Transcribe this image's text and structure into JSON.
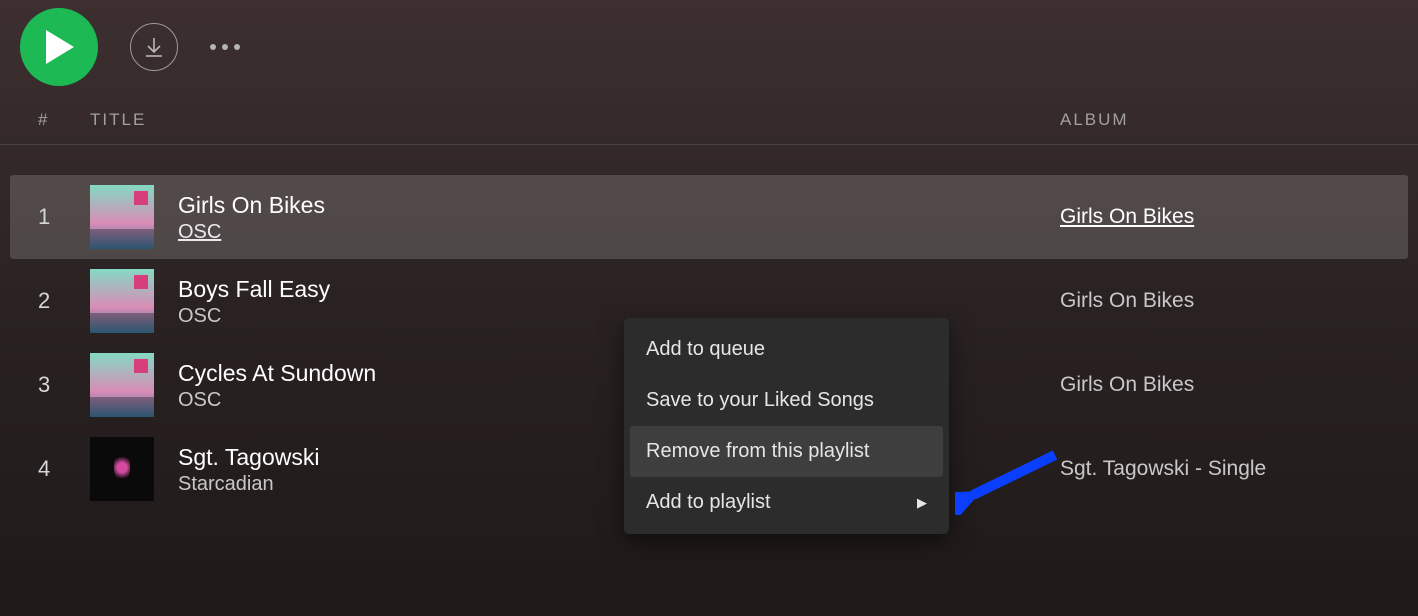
{
  "toolbar": {
    "play_icon": "play-icon",
    "download_icon": "download-icon",
    "more_icon": "more-icon"
  },
  "columns": {
    "number": "#",
    "title": "TITLE",
    "album": "ALBUM"
  },
  "tracks": [
    {
      "num": "1",
      "title": "Girls On Bikes",
      "artist": "OSC",
      "album": "Girls On Bikes",
      "selected": true,
      "art": "synth"
    },
    {
      "num": "2",
      "title": "Boys Fall Easy",
      "artist": "OSC",
      "album": "Girls On Bikes",
      "selected": false,
      "art": "synth"
    },
    {
      "num": "3",
      "title": "Cycles At Sundown",
      "artist": "OSC",
      "album": "Girls On Bikes",
      "selected": false,
      "art": "synth"
    },
    {
      "num": "4",
      "title": "Sgt. Tagowski",
      "artist": "Starcadian",
      "album": "Sgt. Tagowski - Single",
      "selected": false,
      "art": "sgt"
    }
  ],
  "context_menu": {
    "items": [
      {
        "label": "Add to queue",
        "highlight": false,
        "submenu": false
      },
      {
        "label": "Save to your Liked Songs",
        "highlight": false,
        "submenu": false
      },
      {
        "label": "Remove from this playlist",
        "highlight": true,
        "submenu": false
      },
      {
        "label": "Add to playlist",
        "highlight": false,
        "submenu": true
      }
    ]
  },
  "annotation": {
    "arrow_color": "#0a3fff"
  }
}
